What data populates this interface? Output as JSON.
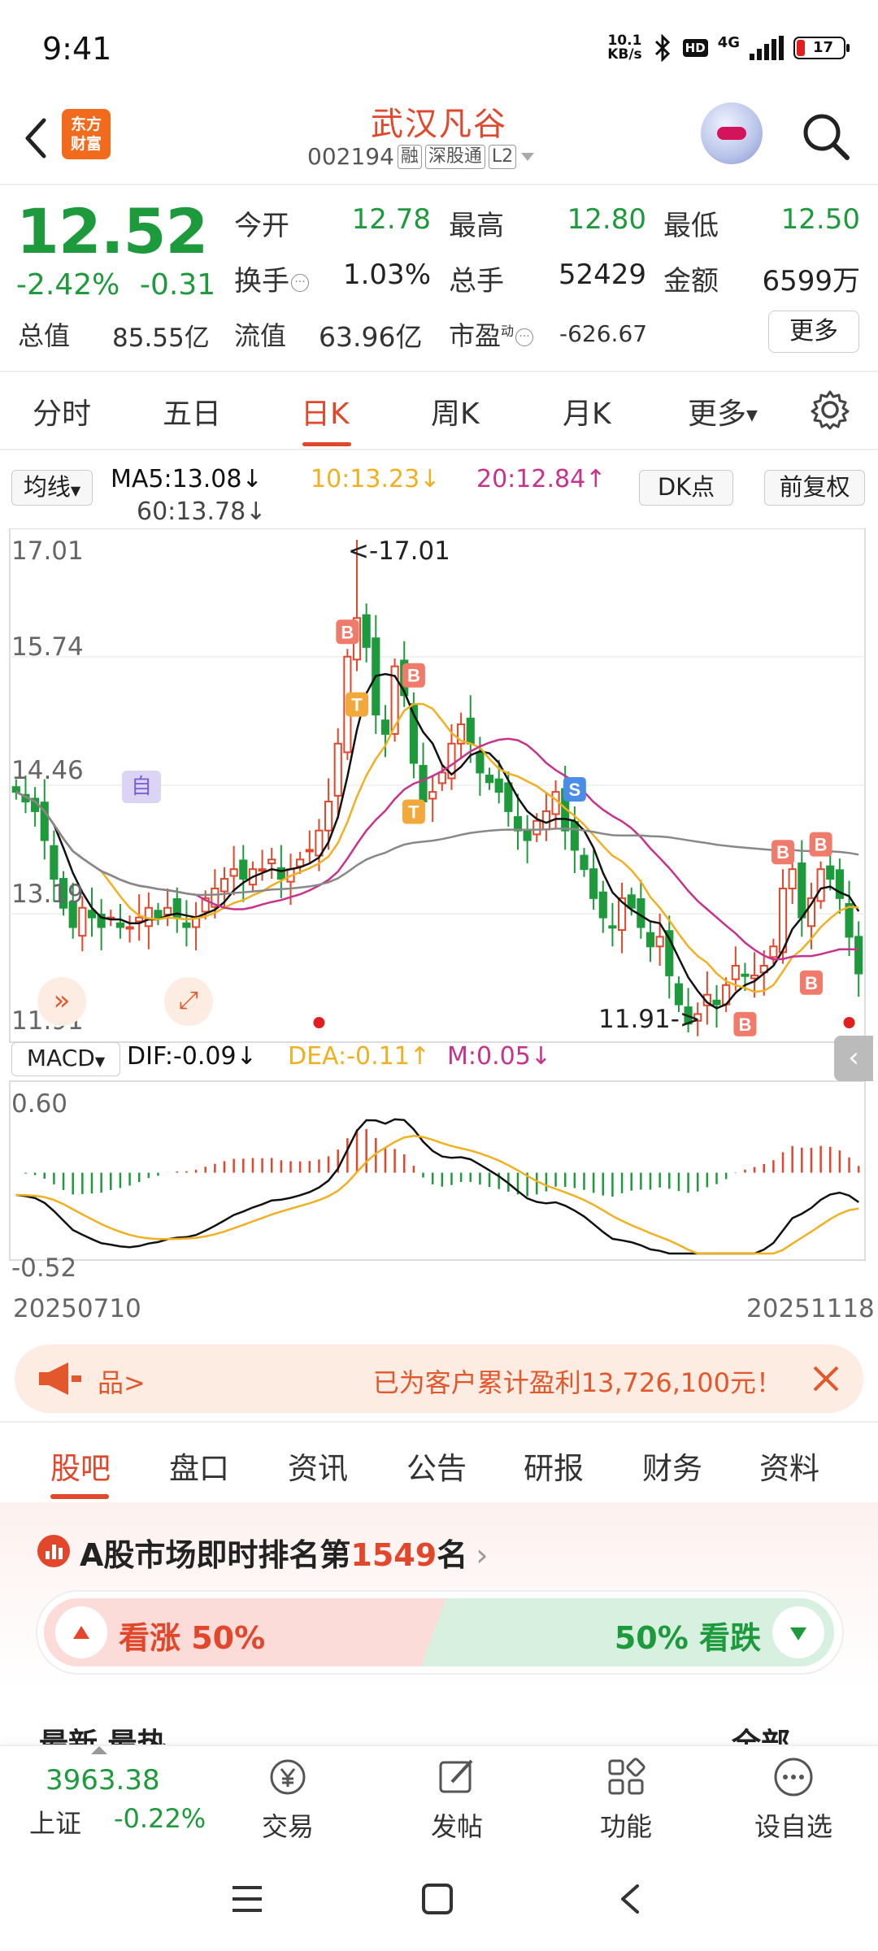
{
  "status_bar": {
    "time": "9:41",
    "net_speed_value": "10.1",
    "net_speed_unit": "KB/s",
    "hd": "HD",
    "signal": "4G",
    "battery": "17"
  },
  "header": {
    "app_logo_line1": "东方",
    "app_logo_line2": "财富",
    "stock_name": "武汉凡谷",
    "stock_code": "002194",
    "tag_margin": "融",
    "tag_connect": "深股通",
    "tag_level": "L2"
  },
  "quote": {
    "price": "12.52",
    "change_pct": "-2.42%",
    "change_abs": "-0.31",
    "open_label": "今开",
    "open": "12.78",
    "high_label": "最高",
    "high": "12.80",
    "low_label": "最低",
    "low": "12.50",
    "turnover_label": "换手",
    "turnover": "1.03%",
    "volume_label": "总手",
    "volume": "52429",
    "amount_label": "金额",
    "amount": "6599万",
    "total_mv_label": "总值",
    "total_mv": "85.55亿",
    "float_mv_label": "流值",
    "float_mv": "63.96亿",
    "pe_label": "市盈",
    "pe_sup": "动",
    "pe": "-626.67",
    "more_label": "更多"
  },
  "kline_tabs": [
    {
      "label": "分时"
    },
    {
      "label": "五日"
    },
    {
      "label": "日K"
    },
    {
      "label": "周K"
    },
    {
      "label": "月K"
    },
    {
      "label": "更多"
    }
  ],
  "ma_bar": {
    "type_label": "均线",
    "ma5": "MA5:13.08↓",
    "ma10": "10:13.23↓",
    "ma20": "20:12.84↑",
    "ma60": "60:13.78↓",
    "dk_label": "DK点",
    "adjust_label": "前复权"
  },
  "colors": {
    "up": "#e2462b",
    "down": "#1d9a3c",
    "ma5": "#111111",
    "ma10": "#f0b020",
    "ma20": "#c8328c",
    "ma60": "#888888"
  },
  "chart_labels": {
    "y_top": "17.01",
    "y_2": "15.74",
    "y_3": "14.46",
    "y_4": "13.19",
    "y_bottom": "11.91",
    "max_note": "<-17.01",
    "min_note": "11.91->",
    "self_marker": "自"
  },
  "macd_bar": {
    "type_label": "MACD",
    "dif": "DIF:-0.09↓",
    "dea": "DEA:-0.11↑",
    "m": "M:0.05↓",
    "y_top": "0.60",
    "y_bottom": "-0.52"
  },
  "dates": {
    "start": "20250710",
    "end": "20251118"
  },
  "chart_data": {
    "type": "candlestick",
    "price_range": [
      11.91,
      17.01
    ],
    "macd_range": [
      -0.52,
      0.6
    ],
    "approx_close": [
      14.4,
      14.3,
      14.2,
      13.9,
      13.5,
      13.2,
      13.0,
      13.2,
      13.1,
      13.0,
      13.1,
      13.0,
      13.0,
      13.1,
      13.2,
      13.1,
      13.2,
      13.1,
      13.0,
      13.1,
      13.3,
      13.4,
      13.5,
      13.6,
      13.5,
      13.6,
      13.6,
      13.7,
      13.5,
      13.6,
      13.7,
      13.8,
      14.0,
      14.3,
      14.9,
      15.8,
      16.2,
      15.9,
      15.2,
      15.0,
      15.7,
      15.4,
      14.7,
      14.3,
      14.4,
      14.6,
      14.9,
      15.1,
      14.9,
      14.6,
      14.5,
      14.4,
      14.2,
      14.0,
      13.9,
      14.1,
      14.2,
      14.4,
      14.0,
      13.8,
      13.6,
      13.3,
      13.1,
      13.0,
      13.3,
      13.2,
      13.0,
      12.8,
      12.9,
      12.5,
      12.2,
      12.0,
      12.1,
      12.3,
      12.2,
      12.4,
      12.6,
      12.5,
      12.5,
      12.6,
      12.8,
      13.4,
      13.6,
      13.1,
      13.3,
      13.6,
      13.5,
      13.3,
      12.9,
      12.52
    ],
    "markers": [
      "B",
      "T",
      "B",
      "T",
      "S",
      "B",
      "B",
      "B",
      "B"
    ]
  },
  "promo": {
    "product": "品>",
    "text": "已为客户累计盈利13,726,100元！"
  },
  "sec_tabs": [
    {
      "label": "股吧"
    },
    {
      "label": "盘口"
    },
    {
      "label": "资讯"
    },
    {
      "label": "公告"
    },
    {
      "label": "研报"
    },
    {
      "label": "财务"
    },
    {
      "label": "资料"
    }
  ],
  "rank": {
    "prefix": "A股市场即时排名第",
    "num": "1549",
    "suffix": "名",
    "vote_up": "看涨 50%",
    "vote_down": "50% 看跌"
  },
  "peek": {
    "text": "最新  最热",
    "right": "全部"
  },
  "bottom_nav": {
    "index_value": "3963.38",
    "index_name": "上证",
    "index_change": "-0.22%",
    "trade": "交易",
    "post": "发帖",
    "function": "功能",
    "watchlist": "设自选"
  }
}
